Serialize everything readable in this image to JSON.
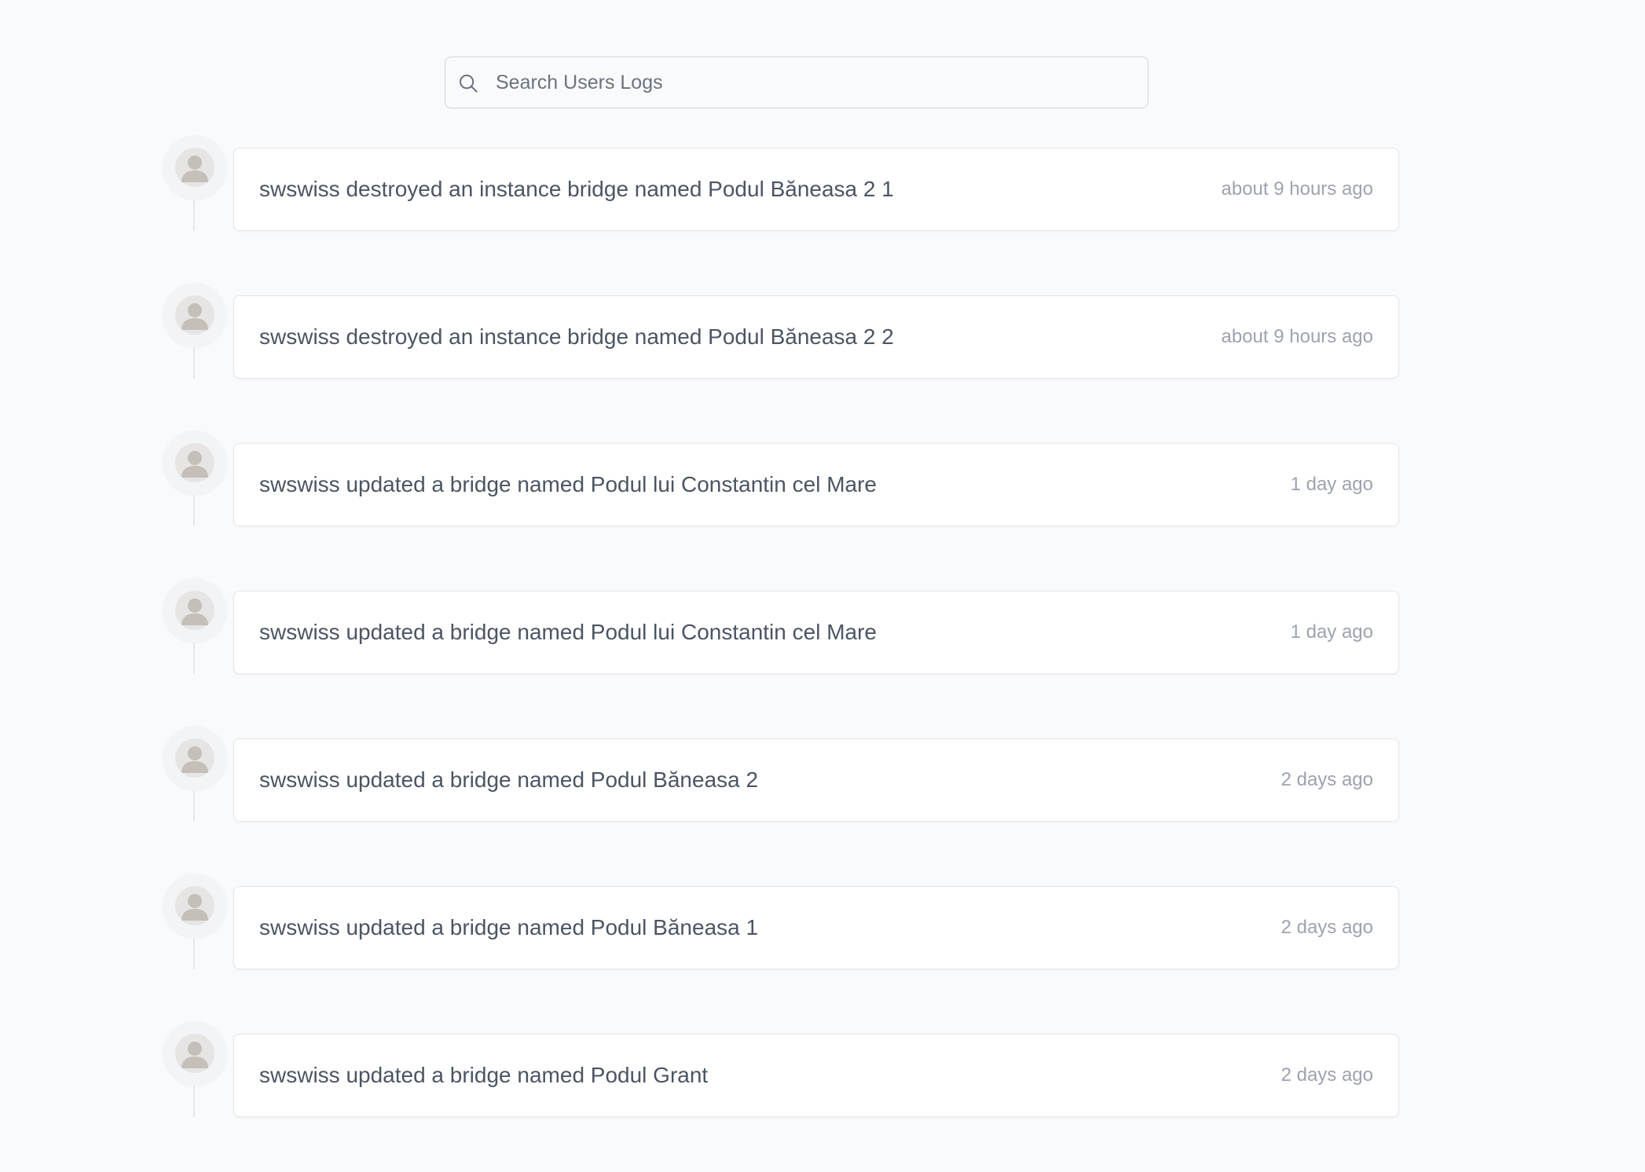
{
  "search": {
    "placeholder": "Search Users Logs",
    "value": "",
    "icon": "search-icon"
  },
  "logs": [
    {
      "message": "swswiss destroyed an instance bridge named Podul Băneasa 2 1",
      "time": "about 9 hours ago",
      "avatar_icon": "user-avatar-icon"
    },
    {
      "message": "swswiss destroyed an instance bridge named Podul Băneasa 2 2",
      "time": "about 9 hours ago",
      "avatar_icon": "user-avatar-icon"
    },
    {
      "message": "swswiss updated a bridge named Podul lui Constantin cel Mare",
      "time": "1 day ago",
      "avatar_icon": "user-avatar-icon"
    },
    {
      "message": "swswiss updated a bridge named Podul lui Constantin cel Mare",
      "time": "1 day ago",
      "avatar_icon": "user-avatar-icon"
    },
    {
      "message": "swswiss updated a bridge named Podul Băneasa 2",
      "time": "2 days ago",
      "avatar_icon": "user-avatar-icon"
    },
    {
      "message": "swswiss updated a bridge named Podul Băneasa 1",
      "time": "2 days ago",
      "avatar_icon": "user-avatar-icon"
    },
    {
      "message": "swswiss updated a bridge named Podul Grant",
      "time": "2 days ago",
      "avatar_icon": "user-avatar-icon"
    }
  ],
  "colors": {
    "background": "#f9fafb",
    "card": "#ffffff",
    "border": "#e5e7eb",
    "text": "#4b5563",
    "muted": "#9ca3af",
    "avatar": "#e7e5e4",
    "avatar_figure": "#c4bfb8"
  }
}
